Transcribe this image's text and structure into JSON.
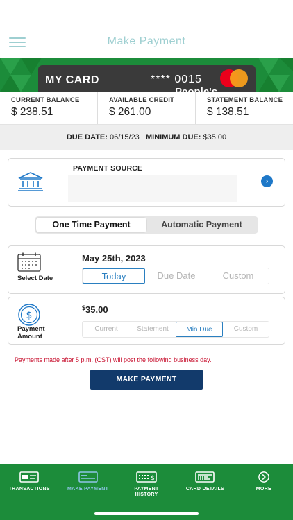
{
  "header": {
    "title": "Make Payment",
    "menu_icon": "hamburger-menu-icon"
  },
  "card": {
    "name": "MY CARD",
    "number_masked": "**** 0015",
    "brand_text": "People's",
    "logo_icon": "mastercard-logo",
    "colors": {
      "banner": "#1c8c3a",
      "card": "#3a3a3a"
    }
  },
  "balances": [
    {
      "label": "CURRENT BALANCE",
      "value": "$ 238.51"
    },
    {
      "label": "AVAILABLE CREDIT",
      "value": "$ 261.00"
    },
    {
      "label": "STATEMENT BALANCE",
      "value": "$ 138.51"
    }
  ],
  "due": {
    "due_date_label": "DUE DATE:",
    "due_date": "06/15/23",
    "min_due_label": "MINIMUM DUE:",
    "min_due": "$35.00"
  },
  "payment_source": {
    "label": "PAYMENT SOURCE",
    "value": "",
    "icon": "bank-icon",
    "arrow_icon": "chevron-right-icon"
  },
  "payment_type": {
    "options": [
      "One Time Payment",
      "Automatic Payment"
    ],
    "selected": "One Time Payment"
  },
  "date": {
    "label": "Select Date",
    "value": "May 25th, 2023",
    "options": [
      "Today",
      "Due Date",
      "Custom"
    ],
    "selected": "Today",
    "icon": "calendar-icon"
  },
  "amount": {
    "label_line1": "Payment",
    "label_line2": "Amount",
    "currency": "$",
    "value": "35.00",
    "options": [
      "Current",
      "Statement",
      "Min Due",
      "Custom"
    ],
    "selected": "Min Due",
    "icon": "dollar-circle-icon"
  },
  "note": "Payments made after 5 p.m. (CST) will post the following business day.",
  "submit_label": "MAKE PAYMENT",
  "bottom_nav": [
    {
      "label": "TRANSACTIONS",
      "icon": "transactions-icon",
      "active": false
    },
    {
      "label": "MAKE PAYMENT",
      "icon": "card-payment-icon",
      "active": true
    },
    {
      "label": "PAYMENT HISTORY",
      "line1": "PAYMENT",
      "line2": "HISTORY",
      "icon": "payment-history-icon",
      "active": false
    },
    {
      "label": "CARD DETAILS",
      "icon": "card-details-icon",
      "active": false
    },
    {
      "label": "MORE",
      "icon": "more-icon",
      "active": false
    }
  ],
  "colors": {
    "accent_blue": "#2a7fc0",
    "primary_button": "#123a6b",
    "nav_green": "#1c8c3a",
    "warning_red": "#c8102e",
    "title_teal": "#9ecfd1"
  }
}
